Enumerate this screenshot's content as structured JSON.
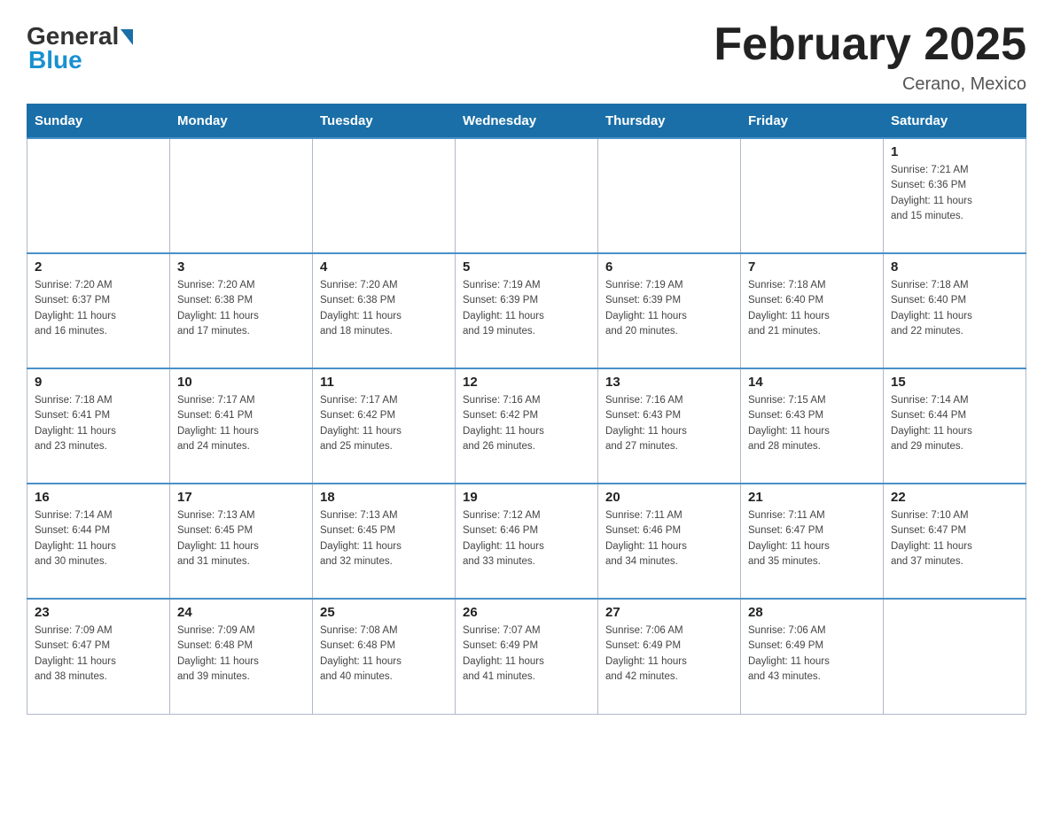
{
  "logo": {
    "general": "General",
    "blue": "Blue"
  },
  "title": "February 2025",
  "location": "Cerano, Mexico",
  "days_of_week": [
    "Sunday",
    "Monday",
    "Tuesday",
    "Wednesday",
    "Thursday",
    "Friday",
    "Saturday"
  ],
  "weeks": [
    [
      {
        "day": "",
        "info": ""
      },
      {
        "day": "",
        "info": ""
      },
      {
        "day": "",
        "info": ""
      },
      {
        "day": "",
        "info": ""
      },
      {
        "day": "",
        "info": ""
      },
      {
        "day": "",
        "info": ""
      },
      {
        "day": "1",
        "info": "Sunrise: 7:21 AM\nSunset: 6:36 PM\nDaylight: 11 hours\nand 15 minutes."
      }
    ],
    [
      {
        "day": "2",
        "info": "Sunrise: 7:20 AM\nSunset: 6:37 PM\nDaylight: 11 hours\nand 16 minutes."
      },
      {
        "day": "3",
        "info": "Sunrise: 7:20 AM\nSunset: 6:38 PM\nDaylight: 11 hours\nand 17 minutes."
      },
      {
        "day": "4",
        "info": "Sunrise: 7:20 AM\nSunset: 6:38 PM\nDaylight: 11 hours\nand 18 minutes."
      },
      {
        "day": "5",
        "info": "Sunrise: 7:19 AM\nSunset: 6:39 PM\nDaylight: 11 hours\nand 19 minutes."
      },
      {
        "day": "6",
        "info": "Sunrise: 7:19 AM\nSunset: 6:39 PM\nDaylight: 11 hours\nand 20 minutes."
      },
      {
        "day": "7",
        "info": "Sunrise: 7:18 AM\nSunset: 6:40 PM\nDaylight: 11 hours\nand 21 minutes."
      },
      {
        "day": "8",
        "info": "Sunrise: 7:18 AM\nSunset: 6:40 PM\nDaylight: 11 hours\nand 22 minutes."
      }
    ],
    [
      {
        "day": "9",
        "info": "Sunrise: 7:18 AM\nSunset: 6:41 PM\nDaylight: 11 hours\nand 23 minutes."
      },
      {
        "day": "10",
        "info": "Sunrise: 7:17 AM\nSunset: 6:41 PM\nDaylight: 11 hours\nand 24 minutes."
      },
      {
        "day": "11",
        "info": "Sunrise: 7:17 AM\nSunset: 6:42 PM\nDaylight: 11 hours\nand 25 minutes."
      },
      {
        "day": "12",
        "info": "Sunrise: 7:16 AM\nSunset: 6:42 PM\nDaylight: 11 hours\nand 26 minutes."
      },
      {
        "day": "13",
        "info": "Sunrise: 7:16 AM\nSunset: 6:43 PM\nDaylight: 11 hours\nand 27 minutes."
      },
      {
        "day": "14",
        "info": "Sunrise: 7:15 AM\nSunset: 6:43 PM\nDaylight: 11 hours\nand 28 minutes."
      },
      {
        "day": "15",
        "info": "Sunrise: 7:14 AM\nSunset: 6:44 PM\nDaylight: 11 hours\nand 29 minutes."
      }
    ],
    [
      {
        "day": "16",
        "info": "Sunrise: 7:14 AM\nSunset: 6:44 PM\nDaylight: 11 hours\nand 30 minutes."
      },
      {
        "day": "17",
        "info": "Sunrise: 7:13 AM\nSunset: 6:45 PM\nDaylight: 11 hours\nand 31 minutes."
      },
      {
        "day": "18",
        "info": "Sunrise: 7:13 AM\nSunset: 6:45 PM\nDaylight: 11 hours\nand 32 minutes."
      },
      {
        "day": "19",
        "info": "Sunrise: 7:12 AM\nSunset: 6:46 PM\nDaylight: 11 hours\nand 33 minutes."
      },
      {
        "day": "20",
        "info": "Sunrise: 7:11 AM\nSunset: 6:46 PM\nDaylight: 11 hours\nand 34 minutes."
      },
      {
        "day": "21",
        "info": "Sunrise: 7:11 AM\nSunset: 6:47 PM\nDaylight: 11 hours\nand 35 minutes."
      },
      {
        "day": "22",
        "info": "Sunrise: 7:10 AM\nSunset: 6:47 PM\nDaylight: 11 hours\nand 37 minutes."
      }
    ],
    [
      {
        "day": "23",
        "info": "Sunrise: 7:09 AM\nSunset: 6:47 PM\nDaylight: 11 hours\nand 38 minutes."
      },
      {
        "day": "24",
        "info": "Sunrise: 7:09 AM\nSunset: 6:48 PM\nDaylight: 11 hours\nand 39 minutes."
      },
      {
        "day": "25",
        "info": "Sunrise: 7:08 AM\nSunset: 6:48 PM\nDaylight: 11 hours\nand 40 minutes."
      },
      {
        "day": "26",
        "info": "Sunrise: 7:07 AM\nSunset: 6:49 PM\nDaylight: 11 hours\nand 41 minutes."
      },
      {
        "day": "27",
        "info": "Sunrise: 7:06 AM\nSunset: 6:49 PM\nDaylight: 11 hours\nand 42 minutes."
      },
      {
        "day": "28",
        "info": "Sunrise: 7:06 AM\nSunset: 6:49 PM\nDaylight: 11 hours\nand 43 minutes."
      },
      {
        "day": "",
        "info": ""
      }
    ]
  ]
}
